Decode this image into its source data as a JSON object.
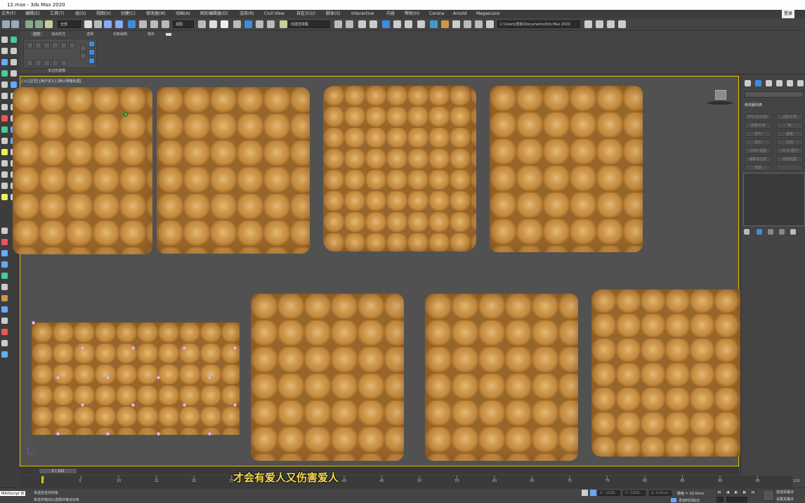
{
  "window": {
    "title": "12.max - 3ds Max 2020"
  },
  "menu": [
    "文件(F)",
    "编辑(E)",
    "工具(T)",
    "组(G)",
    "视图(V)",
    "创建(C)",
    "修改器(M)",
    "动画(A)",
    "图形编辑器(D)",
    "渲染(R)",
    "Civil View",
    "自定义(U)",
    "脚本(S)",
    "Interactive",
    "内容",
    "帮助(H)",
    "Corona",
    "Arnold",
    "Megascans"
  ],
  "account": {
    "label": "登录"
  },
  "toolbar": {
    "selection_filter": "全部",
    "view_dropdown": "视图",
    "named_selection": "创建选择集",
    "project_path": "C:\\Users\\李彬\\Documents\\3ds Max 2020"
  },
  "ribbon": {
    "tabs": [
      "建模",
      "自由形式",
      "选择",
      "对象绘制",
      "填充"
    ],
    "panel_label": "多边形建模"
  },
  "viewport": {
    "label": "[+] [正交] [用户定义] [默认明暗处理]"
  },
  "command_panel": {
    "modifier_list": "修改器列表",
    "buttons": [
      "FFD(长方体)",
      "涡轮平滑",
      "网格平滑",
      "壳",
      "挤出",
      "晶格",
      "挤出",
      "车削",
      "UVW 贴图",
      "UVW 展开",
      "编辑多边形",
      "置换贴图",
      "弯曲",
      ""
    ]
  },
  "timeline": {
    "frame_display": "0 / 100",
    "ticks": [
      "0",
      "5",
      "10",
      "15",
      "20",
      "25",
      "30",
      "35",
      "40",
      "45",
      "50",
      "55",
      "60",
      "65",
      "70",
      "75",
      "80",
      "85",
      "90",
      "95",
      "100"
    ]
  },
  "subtitle": "才会有爱人又伤害爱人",
  "status": {
    "maxscript": "MAXScript 侦",
    "line1": "未选定任何对象",
    "line2": "单击并拖动以选择并移动对象",
    "x": "X: -1000.",
    "y": "Y: -1000.",
    "z": "Z: 0.0mm",
    "grid": "栅格 = 10.0mm",
    "add_time_tag": "添加时间标记",
    "auto_key": "自动关键点",
    "set_key": "设置关键点",
    "selected": "选定对象",
    "key_filters": "关键点过滤器..."
  },
  "colors": {
    "viewport_border": "#e3c000",
    "leather": "#c58a3e",
    "subtitle": "#f5d64a"
  }
}
